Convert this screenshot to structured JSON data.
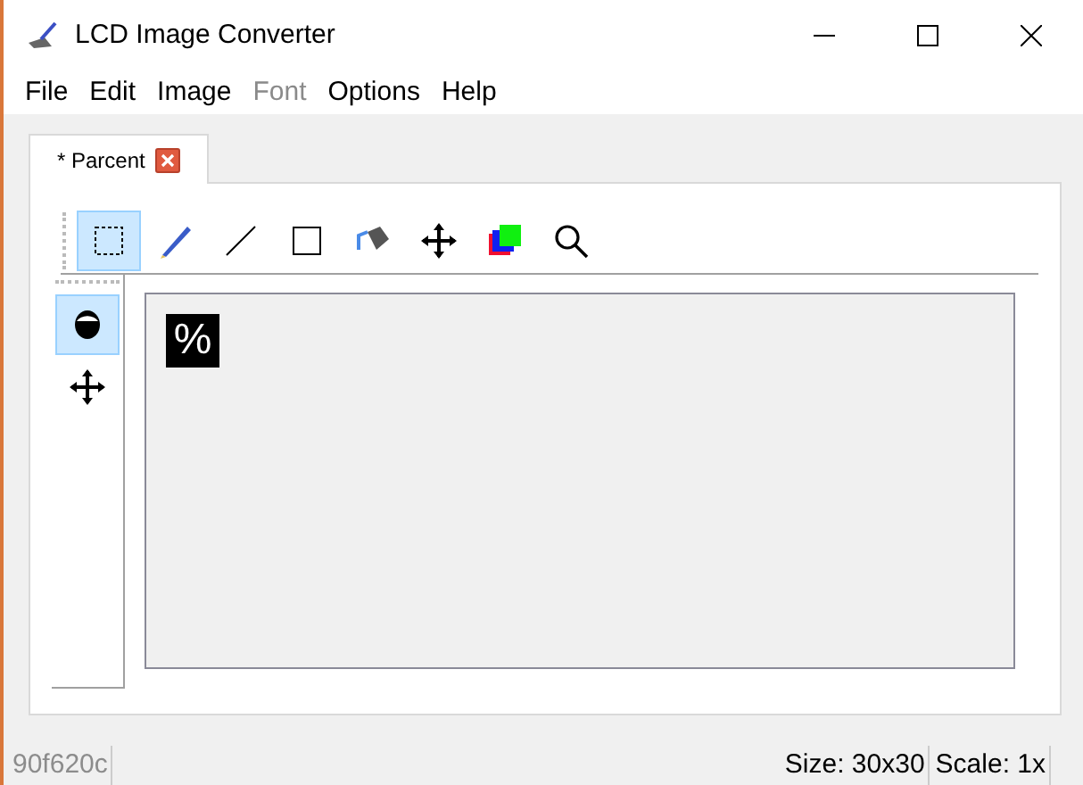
{
  "window": {
    "title": "LCD Image Converter"
  },
  "menu": [
    {
      "label": "File",
      "disabled": false
    },
    {
      "label": "Edit",
      "disabled": false
    },
    {
      "label": "Image",
      "disabled": false
    },
    {
      "label": "Font",
      "disabled": true
    },
    {
      "label": "Options",
      "disabled": false
    },
    {
      "label": "Help",
      "disabled": false
    }
  ],
  "tabs": [
    {
      "label": "* Parcent",
      "selected": true
    }
  ],
  "toolbar": [
    {
      "kind": "select",
      "selected": true
    },
    {
      "kind": "pen",
      "selected": false
    },
    {
      "kind": "line",
      "selected": false
    },
    {
      "kind": "rect",
      "selected": false
    },
    {
      "kind": "fill",
      "selected": false
    },
    {
      "kind": "move",
      "selected": false
    },
    {
      "kind": "colors",
      "selected": false
    },
    {
      "kind": "zoom",
      "selected": false
    }
  ],
  "side_tools": [
    {
      "kind": "mode",
      "selected": true
    },
    {
      "kind": "move",
      "selected": false
    }
  ],
  "canvas": {
    "glyph": "%"
  },
  "status_bar": {
    "hash": "90f620c",
    "size": "Size: 30x30",
    "scale": "Scale: 1x"
  }
}
